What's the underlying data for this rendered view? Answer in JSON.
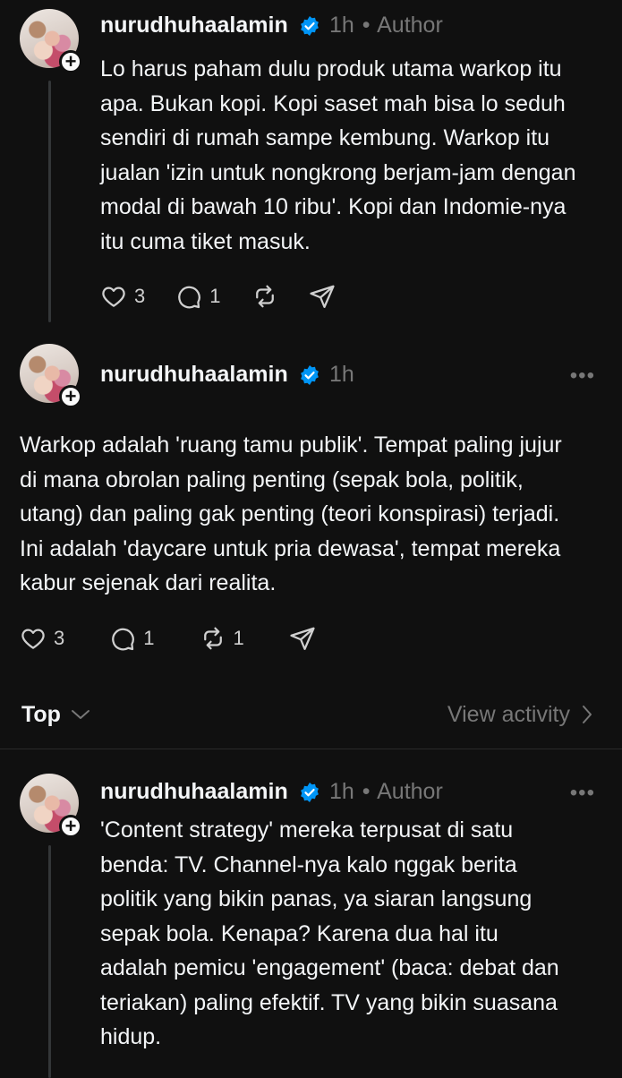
{
  "posts": [
    {
      "username": "nurudhuhaalamin",
      "time": "1h",
      "separator": "•",
      "author_label": "Author",
      "text": "Lo harus paham dulu produk utama warkop itu apa. Bukan kopi. Kopi saset mah bisa lo seduh sendiri di rumah sampe kembung. Warkop itu jualan 'izin untuk nongkrong berjam-jam dengan modal di bawah 10 ribu'. Kopi dan Indomie-nya itu cuma tiket masuk.",
      "likes": "3",
      "replies": "1",
      "reposts": ""
    },
    {
      "username": "nurudhuhaalamin",
      "time": "1h",
      "more": "•••",
      "text": "Warkop adalah 'ruang tamu publik'. Tempat paling jujur di mana obrolan paling penting (sepak bola, politik, utang) dan paling gak penting (teori konspirasi) terjadi. Ini adalah 'daycare untuk pria dewasa', tempat mereka kabur sejenak dari realita.",
      "likes": "3",
      "replies": "1",
      "reposts": "1"
    },
    {
      "username": "nurudhuhaalamin",
      "time": "1h",
      "separator": "•",
      "author_label": "Author",
      "more": "•••",
      "text": "'Content strategy' mereka terpusat di satu benda: TV. Channel-nya kalo nggak berita politik yang bikin panas, ya siaran langsung sepak bola. Kenapa? Karena dua hal itu adalah pemicu 'engagement' (baca: debat dan teriakan) paling efektif. TV yang bikin suasana hidup."
    }
  ],
  "sort_bar": {
    "label": "Top",
    "view_activity": "View activity"
  },
  "colors": {
    "background": "#101010",
    "text": "#f3f5f7",
    "muted": "#777777",
    "verified": "#0095f6"
  }
}
